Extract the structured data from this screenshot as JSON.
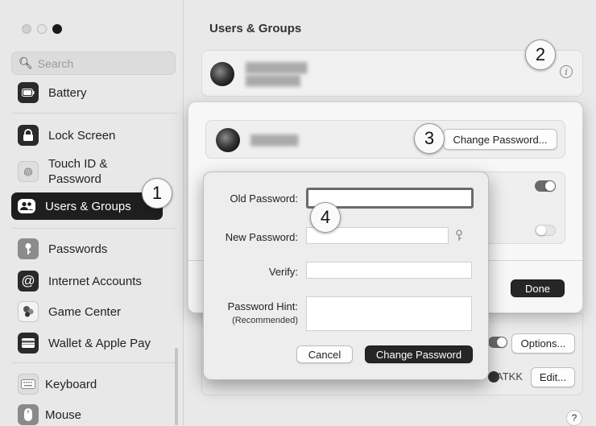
{
  "sidebar": {
    "search_placeholder": "Search",
    "items": [
      {
        "label": "Battery",
        "icon": "battery-icon"
      },
      {
        "label": "Lock Screen",
        "icon": "lock-icon"
      },
      {
        "label": "Touch ID &",
        "label_line2": "Password",
        "icon": "fingerprint-icon"
      },
      {
        "label": "Users & Groups",
        "icon": "users-icon",
        "selected": true
      },
      {
        "label": "Passwords",
        "icon": "key-icon"
      },
      {
        "label": "Internet Accounts",
        "icon": "at-icon"
      },
      {
        "label": "Game Center",
        "icon": "game-center-icon"
      },
      {
        "label": "Wallet & Apple Pay",
        "icon": "wallet-icon"
      },
      {
        "label": "Keyboard",
        "icon": "keyboard-icon"
      },
      {
        "label": "Mouse",
        "icon": "mouse-icon"
      }
    ]
  },
  "main": {
    "title": "Users & Groups"
  },
  "sheet": {
    "change_password_label": "Change Password...",
    "done_label": "Done"
  },
  "password_dialog": {
    "old_password_label": "Old Password:",
    "new_password_label": "New Password:",
    "verify_label": "Verify:",
    "hint_label": "Password Hint:",
    "hint_sub_label": "(Recommended)",
    "cancel_label": "Cancel",
    "submit_label": "Change Password"
  },
  "background": {
    "options_label": "Options...",
    "edit_label": "Edit...",
    "atkk_label": "ATKK",
    "help_label": "?"
  },
  "callouts": [
    "1",
    "2",
    "3",
    "4"
  ],
  "colors": {
    "selected_bg": "#1e1e1e",
    "primary_button": "#262626",
    "focus_ring": "#6a6a6a"
  }
}
